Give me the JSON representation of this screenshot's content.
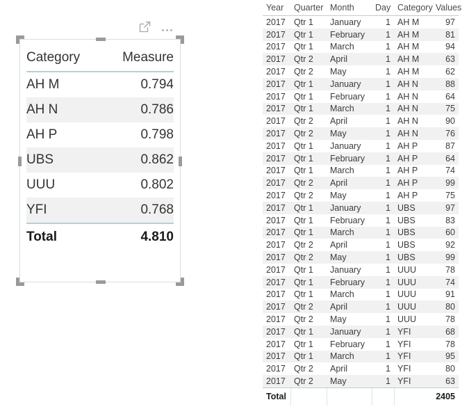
{
  "left_visual": {
    "header_icons": [
      {
        "name": "focus-mode-icon",
        "label": "Focus mode"
      },
      {
        "name": "more-options-icon",
        "label": "More options"
      }
    ],
    "table": {
      "columns": [
        "Category",
        "Measure"
      ],
      "rows": [
        {
          "category": "AH M",
          "measure": "0.794"
        },
        {
          "category": "AH N",
          "measure": "0.786"
        },
        {
          "category": "AH P",
          "measure": "0.798"
        },
        {
          "category": "UBS",
          "measure": "0.862"
        },
        {
          "category": "UUU",
          "measure": "0.802"
        },
        {
          "category": "YFI",
          "measure": "0.768"
        }
      ],
      "total_label": "Total",
      "total_value": "4.810"
    },
    "accent_color": "#a9d6d8",
    "stripe_color": "#f1f1f1",
    "selected": true
  },
  "right_table": {
    "columns": [
      "Year",
      "Quarter",
      "Month",
      "Day",
      "Category",
      "Values"
    ],
    "rows": [
      {
        "year": "2017",
        "quarter": "Qtr 1",
        "month": "January",
        "day": "1",
        "category": "AH M",
        "values": "97"
      },
      {
        "year": "2017",
        "quarter": "Qtr 1",
        "month": "February",
        "day": "1",
        "category": "AH M",
        "values": "81"
      },
      {
        "year": "2017",
        "quarter": "Qtr 1",
        "month": "March",
        "day": "1",
        "category": "AH M",
        "values": "94"
      },
      {
        "year": "2017",
        "quarter": "Qtr 2",
        "month": "April",
        "day": "1",
        "category": "AH M",
        "values": "63"
      },
      {
        "year": "2017",
        "quarter": "Qtr 2",
        "month": "May",
        "day": "1",
        "category": "AH M",
        "values": "62"
      },
      {
        "year": "2017",
        "quarter": "Qtr 1",
        "month": "January",
        "day": "1",
        "category": "AH N",
        "values": "88"
      },
      {
        "year": "2017",
        "quarter": "Qtr 1",
        "month": "February",
        "day": "1",
        "category": "AH N",
        "values": "64"
      },
      {
        "year": "2017",
        "quarter": "Qtr 1",
        "month": "March",
        "day": "1",
        "category": "AH N",
        "values": "75"
      },
      {
        "year": "2017",
        "quarter": "Qtr 2",
        "month": "April",
        "day": "1",
        "category": "AH N",
        "values": "90"
      },
      {
        "year": "2017",
        "quarter": "Qtr 2",
        "month": "May",
        "day": "1",
        "category": "AH N",
        "values": "76"
      },
      {
        "year": "2017",
        "quarter": "Qtr 1",
        "month": "January",
        "day": "1",
        "category": "AH P",
        "values": "87"
      },
      {
        "year": "2017",
        "quarter": "Qtr 1",
        "month": "February",
        "day": "1",
        "category": "AH P",
        "values": "64"
      },
      {
        "year": "2017",
        "quarter": "Qtr 1",
        "month": "March",
        "day": "1",
        "category": "AH P",
        "values": "74"
      },
      {
        "year": "2017",
        "quarter": "Qtr 2",
        "month": "April",
        "day": "1",
        "category": "AH P",
        "values": "99"
      },
      {
        "year": "2017",
        "quarter": "Qtr 2",
        "month": "May",
        "day": "1",
        "category": "AH P",
        "values": "75"
      },
      {
        "year": "2017",
        "quarter": "Qtr 1",
        "month": "January",
        "day": "1",
        "category": "UBS",
        "values": "97"
      },
      {
        "year": "2017",
        "quarter": "Qtr 1",
        "month": "February",
        "day": "1",
        "category": "UBS",
        "values": "83"
      },
      {
        "year": "2017",
        "quarter": "Qtr 1",
        "month": "March",
        "day": "1",
        "category": "UBS",
        "values": "60"
      },
      {
        "year": "2017",
        "quarter": "Qtr 2",
        "month": "April",
        "day": "1",
        "category": "UBS",
        "values": "92"
      },
      {
        "year": "2017",
        "quarter": "Qtr 2",
        "month": "May",
        "day": "1",
        "category": "UBS",
        "values": "99"
      },
      {
        "year": "2017",
        "quarter": "Qtr 1",
        "month": "January",
        "day": "1",
        "category": "UUU",
        "values": "78"
      },
      {
        "year": "2017",
        "quarter": "Qtr 1",
        "month": "February",
        "day": "1",
        "category": "UUU",
        "values": "74"
      },
      {
        "year": "2017",
        "quarter": "Qtr 1",
        "month": "March",
        "day": "1",
        "category": "UUU",
        "values": "91"
      },
      {
        "year": "2017",
        "quarter": "Qtr 2",
        "month": "April",
        "day": "1",
        "category": "UUU",
        "values": "80"
      },
      {
        "year": "2017",
        "quarter": "Qtr 2",
        "month": "May",
        "day": "1",
        "category": "UUU",
        "values": "78"
      },
      {
        "year": "2017",
        "quarter": "Qtr 1",
        "month": "January",
        "day": "1",
        "category": "YFI",
        "values": "68"
      },
      {
        "year": "2017",
        "quarter": "Qtr 1",
        "month": "February",
        "day": "1",
        "category": "YFI",
        "values": "78"
      },
      {
        "year": "2017",
        "quarter": "Qtr 1",
        "month": "March",
        "day": "1",
        "category": "YFI",
        "values": "95"
      },
      {
        "year": "2017",
        "quarter": "Qtr 2",
        "month": "April",
        "day": "1",
        "category": "YFI",
        "values": "80"
      },
      {
        "year": "2017",
        "quarter": "Qtr 2",
        "month": "May",
        "day": "1",
        "category": "YFI",
        "values": "63"
      }
    ],
    "total_label": "Total",
    "total_value": "2405",
    "accent_color": "#a9d6d8",
    "stripe_color": "#f1f1f1"
  }
}
